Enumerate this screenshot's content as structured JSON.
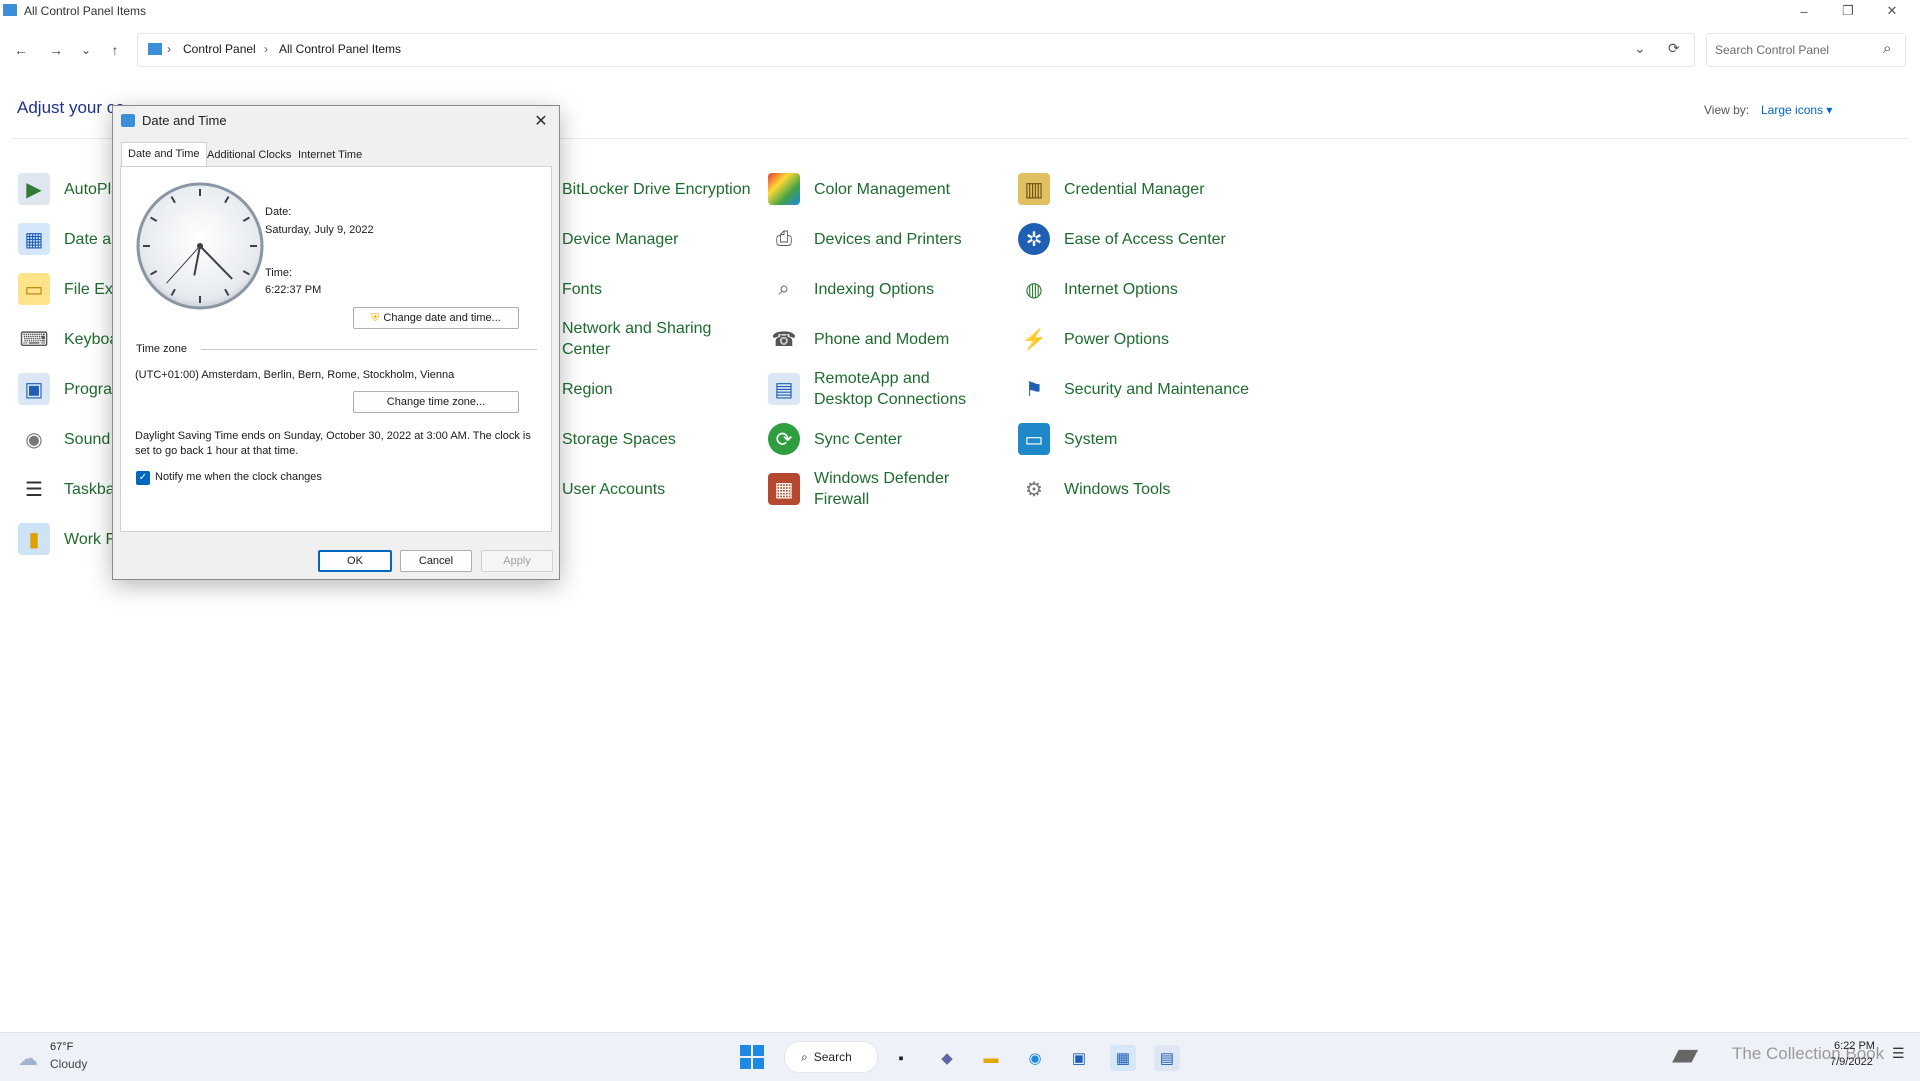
{
  "window": {
    "title": "All Control Panel Items",
    "minimize": "–",
    "restore": "❐",
    "close": "✕"
  },
  "nav": {
    "back": "←",
    "forward": "→",
    "recent": "⌄",
    "up": "↑"
  },
  "address": {
    "crumbs": [
      "Control Panel",
      "All Control Panel Items"
    ],
    "separator": "›",
    "dropdown": "⌄",
    "refresh": "⟳"
  },
  "search": {
    "placeholder": "Search Control Panel",
    "icon": "⌕"
  },
  "main": {
    "heading": "Adjust your co",
    "view_by_label": "View by:",
    "view_by_value": "Large icons ▾",
    "items": [
      {
        "label": "AutoPla",
        "icon": "autoplay-icon"
      },
      {
        "label": "Date ar",
        "icon": "date-time-icon"
      },
      {
        "label": "File Exp",
        "icon": "file-explorer-icon"
      },
      {
        "label": "Keyboa",
        "icon": "keyboard-icon"
      },
      {
        "label": "Progra",
        "icon": "programs-icon"
      },
      {
        "label": "Sound",
        "icon": "sound-icon"
      },
      {
        "label": "Taskbar",
        "icon": "taskbar-icon"
      },
      {
        "label": "Work F",
        "icon": "work-folders-icon"
      },
      {
        "label": "BitLocker Drive Encryption"
      },
      {
        "label": "Device Manager"
      },
      {
        "label": "Fonts"
      },
      {
        "label": "Network and Sharing Center"
      },
      {
        "label": "Region"
      },
      {
        "label": "Storage Spaces"
      },
      {
        "label": "User Accounts"
      },
      {
        "label": "Color Management",
        "icon": "color-management-icon"
      },
      {
        "label": "Devices and Printers",
        "icon": "devices-printers-icon"
      },
      {
        "label": "Indexing Options",
        "icon": "indexing-icon"
      },
      {
        "label": "Phone and Modem",
        "icon": "phone-modem-icon"
      },
      {
        "label": "RemoteApp and Desktop Connections",
        "icon": "remoteapp-icon"
      },
      {
        "label": "Sync Center",
        "icon": "sync-icon"
      },
      {
        "label": "Windows Defender Firewall",
        "icon": "firewall-icon"
      },
      {
        "label": "Credential Manager",
        "icon": "credential-icon"
      },
      {
        "label": "Ease of Access Center",
        "icon": "ease-of-access-icon"
      },
      {
        "label": "Internet Options",
        "icon": "internet-options-icon"
      },
      {
        "label": "Power Options",
        "icon": "power-icon"
      },
      {
        "label": "Security and Maintenance",
        "icon": "security-flag-icon"
      },
      {
        "label": "System",
        "icon": "system-monitor-icon"
      },
      {
        "label": "Windows Tools",
        "icon": "tools-gear-icon"
      }
    ]
  },
  "dialog": {
    "title": "Date and Time",
    "close": "✕",
    "tabs": [
      "Date and Time",
      "Additional Clocks",
      "Internet Time"
    ],
    "date_label": "Date:",
    "date_value": "Saturday, July 9, 2022",
    "time_label": "Time:",
    "time_value": "6:22:37 PM",
    "change_datetime_btn": "Change date and time...",
    "timezone_label": "Time zone",
    "timezone_value": "(UTC+01:00) Amsterdam, Berlin, Bern, Rome, Stockholm, Vienna",
    "change_timezone_btn": "Change time zone...",
    "dst_text": "Daylight Saving Time ends on Sunday, October 30, 2022 at 3:00 AM. The clock is set to go back 1 hour at that time.",
    "notify_label": "Notify me when the clock changes",
    "notify_checked": true,
    "ok": "OK",
    "cancel": "Cancel",
    "apply": "Apply"
  },
  "taskbar": {
    "weather_temp": "67°F",
    "weather_desc": "Cloudy",
    "search_label": "Search",
    "time": "6:22 PM",
    "date": "7/9/2022",
    "watermark": "The Collection Book"
  }
}
